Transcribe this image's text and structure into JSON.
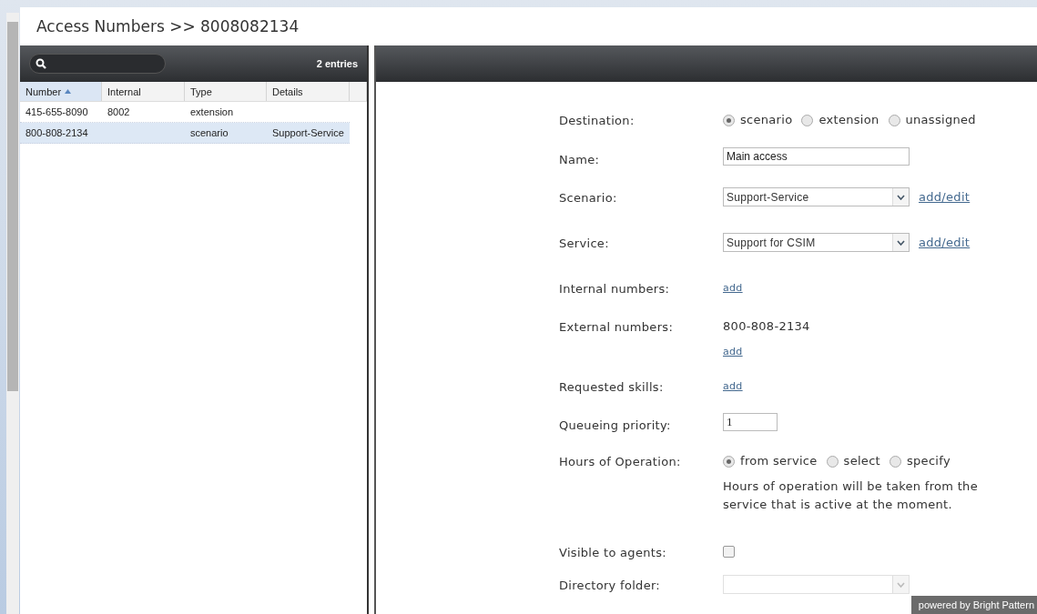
{
  "window": {
    "title": "Access Numbers >> 8008082134"
  },
  "list": {
    "entry_count": "2 entries",
    "columns": [
      {
        "label": "Number",
        "sorted": true
      },
      {
        "label": "Internal",
        "sorted": false
      },
      {
        "label": "Type",
        "sorted": false
      },
      {
        "label": "Details",
        "sorted": false
      }
    ],
    "rows": [
      {
        "cells": [
          "415-655-8090",
          "8002",
          "extension",
          ""
        ],
        "selected": false
      },
      {
        "cells": [
          "800-808-2134",
          "",
          "scenario",
          "Support-Service"
        ],
        "selected": true
      }
    ]
  },
  "form": {
    "fields": [
      {
        "kind": "radio",
        "label": "Destination:",
        "options": [
          {
            "label": "scenario",
            "selected": true
          },
          {
            "label": "extension",
            "selected": false
          },
          {
            "label": "unassigned",
            "selected": false
          }
        ]
      },
      {
        "kind": "text",
        "label": "Name:",
        "value": "Main access"
      },
      {
        "kind": "select",
        "label": "Scenario:",
        "value": "Support-Service",
        "link": "add/edit",
        "disabled": false
      },
      {
        "kind": "select",
        "label": "Service:",
        "value": "Support for CSIM",
        "link": "add/edit",
        "disabled": false
      },
      {
        "kind": "list",
        "label": "Internal numbers:",
        "link": "add"
      },
      {
        "kind": "list",
        "label": "External numbers:",
        "values": [
          "800-808-2134"
        ],
        "link": "add"
      },
      {
        "kind": "list",
        "label": "Requested skills:",
        "link": "add"
      },
      {
        "kind": "number",
        "label": "Queueing priority:",
        "value": "1"
      },
      {
        "kind": "radio",
        "label": "Hours of Operation:",
        "options": [
          {
            "label": "from service",
            "selected": true
          },
          {
            "label": "select",
            "selected": false
          },
          {
            "label": "specify",
            "selected": false
          }
        ],
        "note": "Hours of operation will be taken from the service that is active at the moment."
      },
      {
        "kind": "checkbox",
        "label": "Visible to agents:",
        "checked": false
      },
      {
        "kind": "select",
        "label": "Directory folder:",
        "disabled": true
      }
    ]
  },
  "footer": "powered by Bright Pattern"
}
